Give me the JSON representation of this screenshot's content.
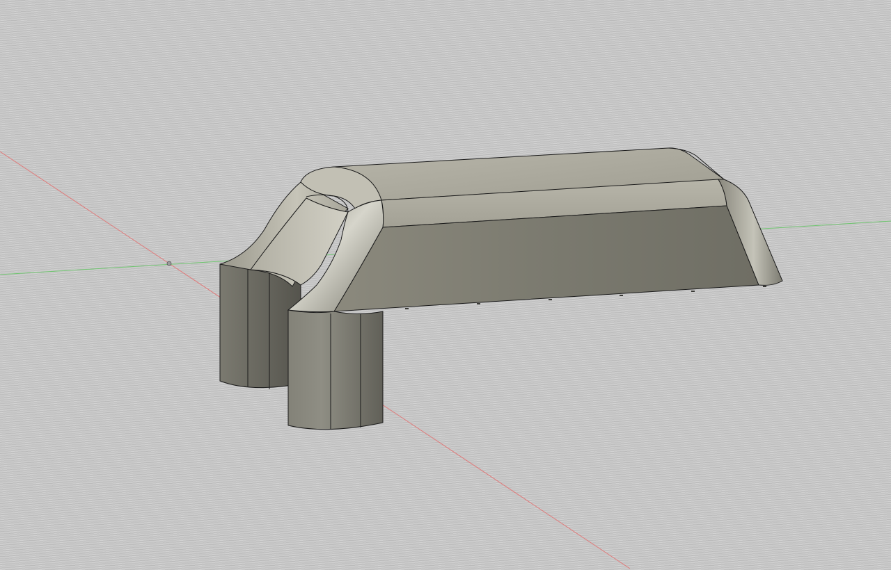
{
  "scene": {
    "background_color": "#cacaca",
    "x_axis_color": "#e07a7a",
    "y_axis_color": "#6fc46f",
    "model": {
      "body_color": "#8c8a7f",
      "edge_color": "#1a1a1a"
    }
  }
}
